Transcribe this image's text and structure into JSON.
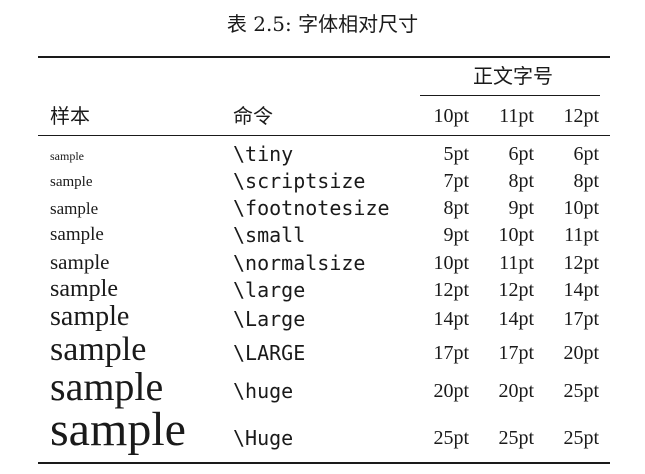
{
  "caption": "表 2.5: 字体相对尺寸",
  "header": {
    "col_sample": "样本",
    "col_command": "命令",
    "group": "正文字号",
    "sizes": [
      "10pt",
      "11pt",
      "12pt"
    ]
  },
  "rows": [
    {
      "sample": "sample",
      "command": "\\tiny",
      "v10": "5pt",
      "v11": "6pt",
      "v12": "6pt"
    },
    {
      "sample": "sample",
      "command": "\\scriptsize",
      "v10": "7pt",
      "v11": "8pt",
      "v12": "8pt"
    },
    {
      "sample": "sample",
      "command": "\\footnotesize",
      "v10": "8pt",
      "v11": "9pt",
      "v12": "10pt"
    },
    {
      "sample": "sample",
      "command": "\\small",
      "v10": "9pt",
      "v11": "10pt",
      "v12": "11pt"
    },
    {
      "sample": "sample",
      "command": "\\normalsize",
      "v10": "10pt",
      "v11": "11pt",
      "v12": "12pt"
    },
    {
      "sample": "sample",
      "command": "\\large",
      "v10": "12pt",
      "v11": "12pt",
      "v12": "14pt"
    },
    {
      "sample": "sample",
      "command": "\\Large",
      "v10": "14pt",
      "v11": "14pt",
      "v12": "17pt"
    },
    {
      "sample": "sample",
      "command": "\\LARGE",
      "v10": "17pt",
      "v11": "17pt",
      "v12": "20pt"
    },
    {
      "sample": "sample",
      "command": "\\huge",
      "v10": "20pt",
      "v11": "20pt",
      "v12": "25pt"
    },
    {
      "sample": "sample",
      "command": "\\Huge",
      "v10": "25pt",
      "v11": "25pt",
      "v12": "25pt"
    }
  ]
}
